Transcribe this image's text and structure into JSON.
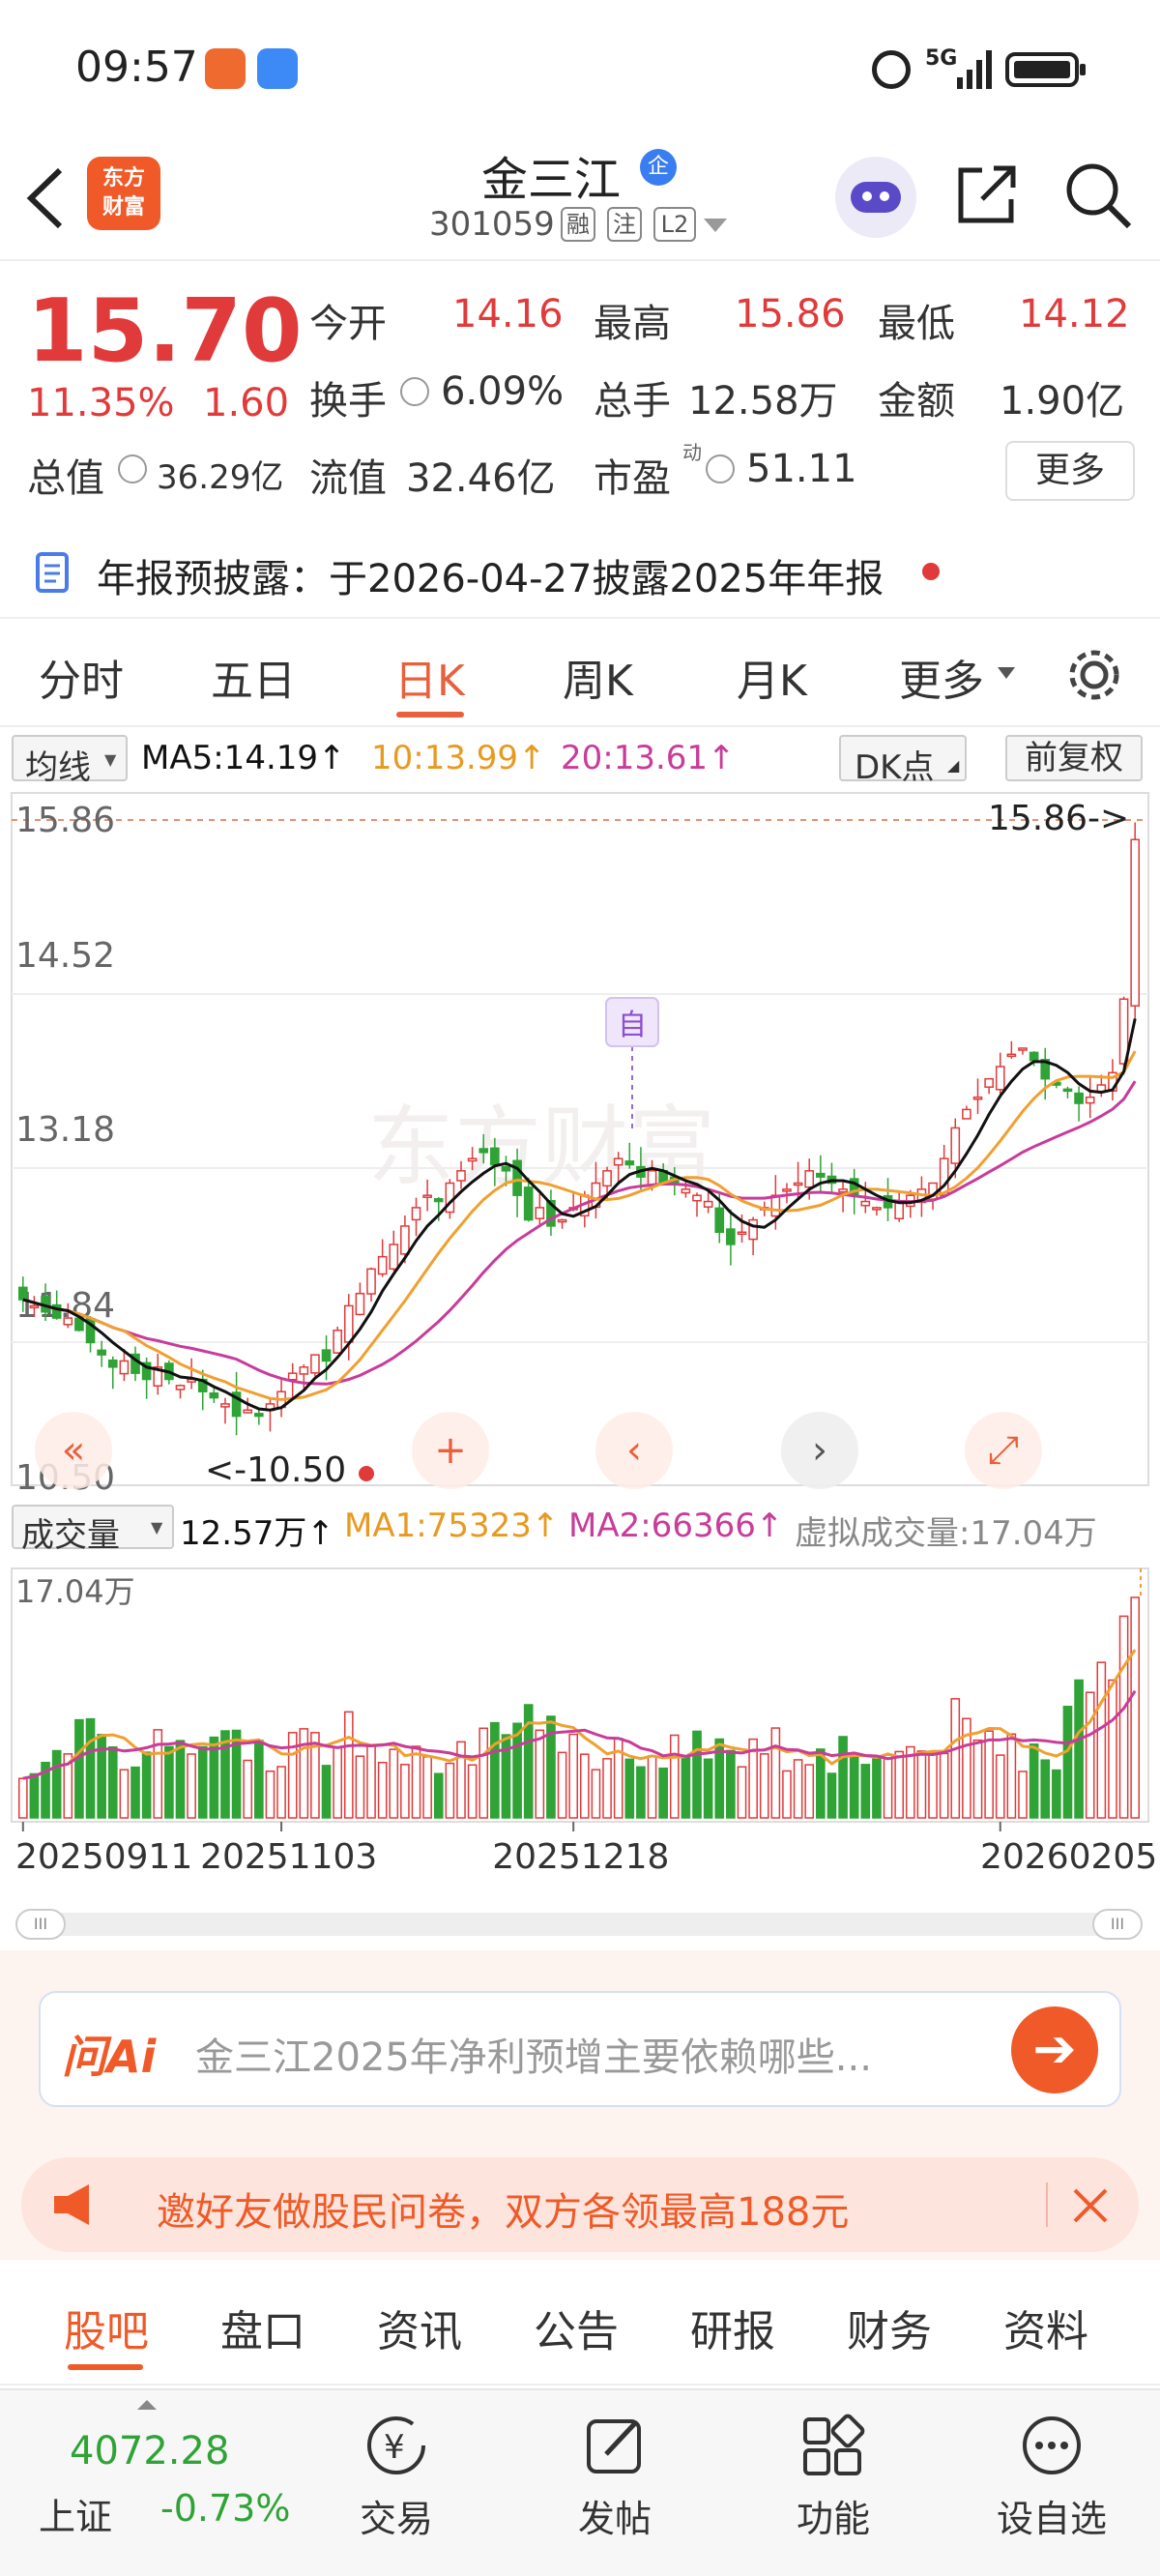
{
  "status": {
    "time": "09:57",
    "network": "5G"
  },
  "header": {
    "stock_name": "金三江",
    "cert_badge": "企",
    "code": "301059",
    "tags": [
      "融",
      "注",
      "L2"
    ]
  },
  "quote": {
    "price": "15.70",
    "change_pct": "11.35%",
    "change_amt": "1.60",
    "fields": [
      {
        "label": "今开",
        "value": "14.16"
      },
      {
        "label": "最高",
        "value": "15.86"
      },
      {
        "label": "最低",
        "value": "14.12"
      },
      {
        "label": "换手",
        "value": "6.09%"
      },
      {
        "label": "总手",
        "value": "12.58万"
      },
      {
        "label": "金额",
        "value": "1.90亿"
      },
      {
        "label": "总值",
        "value": "36.29亿"
      },
      {
        "label": "流值",
        "value": "32.46亿"
      },
      {
        "label": "市盈",
        "label_sup": "动",
        "value": "51.11"
      }
    ],
    "more_button": "更多",
    "notice": "年报预披露：于2026-04-27披露2025年年报"
  },
  "tabs": {
    "items": [
      "分时",
      "五日",
      "日K",
      "周K",
      "月K",
      "更多"
    ],
    "active": "日K"
  },
  "chart": {
    "ma_selector": "均线",
    "ma5": "MA5:14.19↑",
    "ma10": "10:13.99↑",
    "ma20": "20:13.61↑",
    "dk_button": "DK点",
    "adjust_button": "前复权",
    "y_ticks": [
      "15.86",
      "14.52",
      "13.18",
      "11.84",
      "10.50"
    ],
    "max_label": "15.86->",
    "min_label": "<-10.50",
    "marker": "自",
    "watermark": "东方财富",
    "vol_selector": "成交量",
    "vol_value": "12.57万↑",
    "vol_ma1": "MA1:75323↑",
    "vol_ma2": "MA2:66366↑",
    "virtual_vol": "虚拟成交量:17.04万",
    "vol_max": "17.04万",
    "dates": [
      "20250911",
      "20251103",
      "20251218",
      "20260205"
    ],
    "colors": {
      "up": "#e03a3a",
      "down": "#2fa336",
      "ma5": "#111111",
      "ma10": "#f0a030",
      "ma20": "#c83c9a"
    }
  },
  "chart_data": {
    "type": "candlestick",
    "ylim": [
      10.5,
      15.86
    ],
    "y_ticks": [
      15.86,
      14.52,
      13.18,
      11.84,
      10.5
    ],
    "x_ticks": [
      "20250911",
      "20251103",
      "20251218",
      "20260205"
    ],
    "close_trend": [
      11.95,
      11.9,
      11.85,
      11.8,
      11.8,
      11.7,
      11.6,
      11.5,
      11.4,
      11.45,
      11.35,
      11.3,
      11.4,
      11.3,
      11.25,
      11.3,
      11.2,
      11.15,
      11.1,
      11.0,
      11.05,
      11.0,
      11.1,
      11.2,
      11.35,
      11.4,
      11.5,
      11.45,
      11.7,
      11.9,
      12.0,
      12.2,
      12.3,
      12.4,
      12.55,
      12.7,
      12.8,
      12.75,
      12.9,
      13.0,
      13.1,
      13.15,
      13.05,
      13.0,
      12.8,
      12.6,
      12.7,
      12.55,
      12.6,
      12.7,
      12.8,
      12.9,
      13.0,
      13.1,
      13.05,
      12.95,
      13.0,
      12.9,
      12.9,
      12.85,
      12.8,
      12.75,
      12.5,
      12.4,
      12.5,
      12.6,
      12.7,
      12.8,
      12.85,
      12.9,
      13.0,
      12.95,
      12.9,
      12.85,
      12.8,
      12.75,
      12.7,
      12.7,
      12.75,
      12.8,
      12.85,
      12.9,
      13.1,
      13.35,
      13.5,
      13.6,
      13.75,
      13.85,
      13.95,
      14.0,
      13.9,
      13.75,
      13.7,
      13.65,
      13.55,
      13.6,
      13.7,
      13.8,
      14.4,
      15.7
    ],
    "ma5": "14.19",
    "ma10": "13.99",
    "ma20": "13.61",
    "volume": {
      "max": "17.04万",
      "last": "12.57万",
      "ma1": 75323,
      "ma2": 66366
    }
  },
  "ai_bar": {
    "logo": "问Ai",
    "question": "金三江2025年净利预增主要依赖哪些..."
  },
  "promo": {
    "text": "邀好友做股民问卷，双方各领最高188元"
  },
  "sub_tabs": {
    "items": [
      "股吧",
      "盘口",
      "资讯",
      "公告",
      "研报",
      "财务",
      "资料"
    ],
    "active": "股吧"
  },
  "bottom": {
    "index_value": "4072.28",
    "index_name": "上证",
    "index_change": "-0.73%",
    "nav": [
      "交易",
      "发帖",
      "功能",
      "设自选"
    ]
  }
}
